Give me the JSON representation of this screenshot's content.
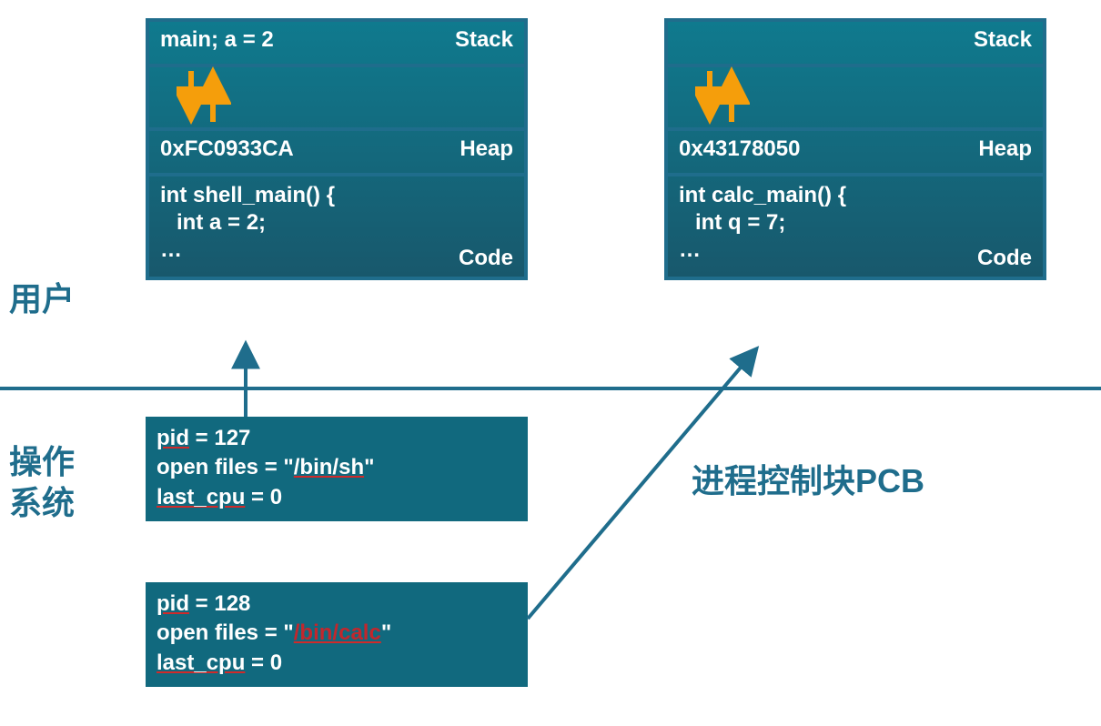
{
  "labels": {
    "user": "用户",
    "os": "操作\n系统",
    "pcb_title": "进程控制块PCB"
  },
  "proc1": {
    "stack_value": "main; a = 2",
    "stack_name": "Stack",
    "heap_value": "0xFC0933CA",
    "heap_name": "Heap",
    "code_line1": "int shell_main() {",
    "code_line2": "int a = 2;",
    "code_line3": "…",
    "code_name": "Code"
  },
  "proc2": {
    "stack_value": "",
    "stack_name": "Stack",
    "heap_value": "0x43178050",
    "heap_name": "Heap",
    "code_line1": "int calc_main() {",
    "code_line2": "int q = 7;",
    "code_line3": "…",
    "code_name": "Code"
  },
  "pcb1": {
    "pid_label": "pid",
    "pid_eq": " = 127",
    "files_label": "open files = ",
    "files_quote_open": "  \"",
    "files_path": "/bin/sh",
    "files_quote_close": "\"",
    "lastcpu_label": "last_cpu",
    "lastcpu_eq": " = 0"
  },
  "pcb2": {
    "pid_label": "pid",
    "pid_eq": " = 128",
    "files_label": "open files = ",
    "files_quote_open": "  \"",
    "files_path": "/bin/calc",
    "files_quote_close": "\"",
    "lastcpu_label": "last_cpu",
    "lastcpu_eq": " = 0"
  },
  "colors": {
    "border": "#1f6d8c",
    "box_bg_top": "#0f7a8e",
    "box_bg_bottom": "#18586c",
    "arrow_orange": "#f59e0b",
    "arrow_blue": "#1f6d8c",
    "underline_red": "#d02a2a"
  }
}
